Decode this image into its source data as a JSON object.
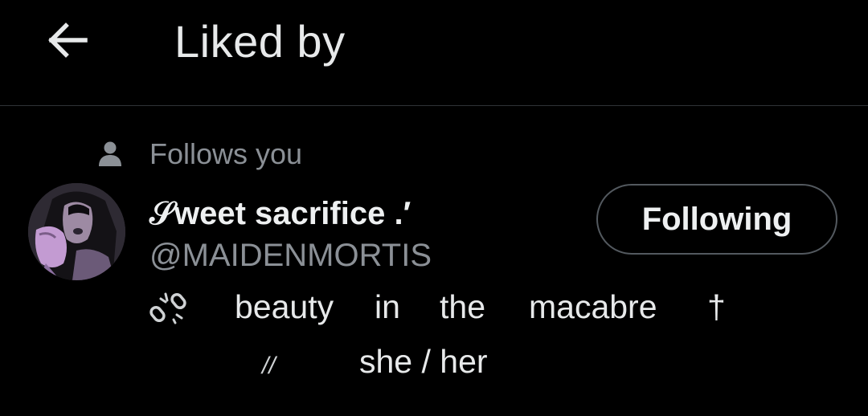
{
  "header": {
    "back_icon": "arrow-left-icon",
    "title": "Liked by"
  },
  "user": {
    "context_icon": "person-icon",
    "context_label": "Follows you",
    "display_name": "𝒮weet sacrifice .′",
    "handle": "@MAIDENMORTIS",
    "follow_button_label": "Following",
    "bio": {
      "icon": "broken-chain-icon",
      "line1_words": [
        "beauty",
        "in",
        "the",
        "macabre",
        "†"
      ],
      "slashes": "//",
      "line2_text": "she / her"
    }
  },
  "colors": {
    "background": "#000000",
    "divider": "#2f3336",
    "primary_text": "#e7e9ea",
    "secondary_text": "#8b9096",
    "button_border": "#53595f"
  }
}
